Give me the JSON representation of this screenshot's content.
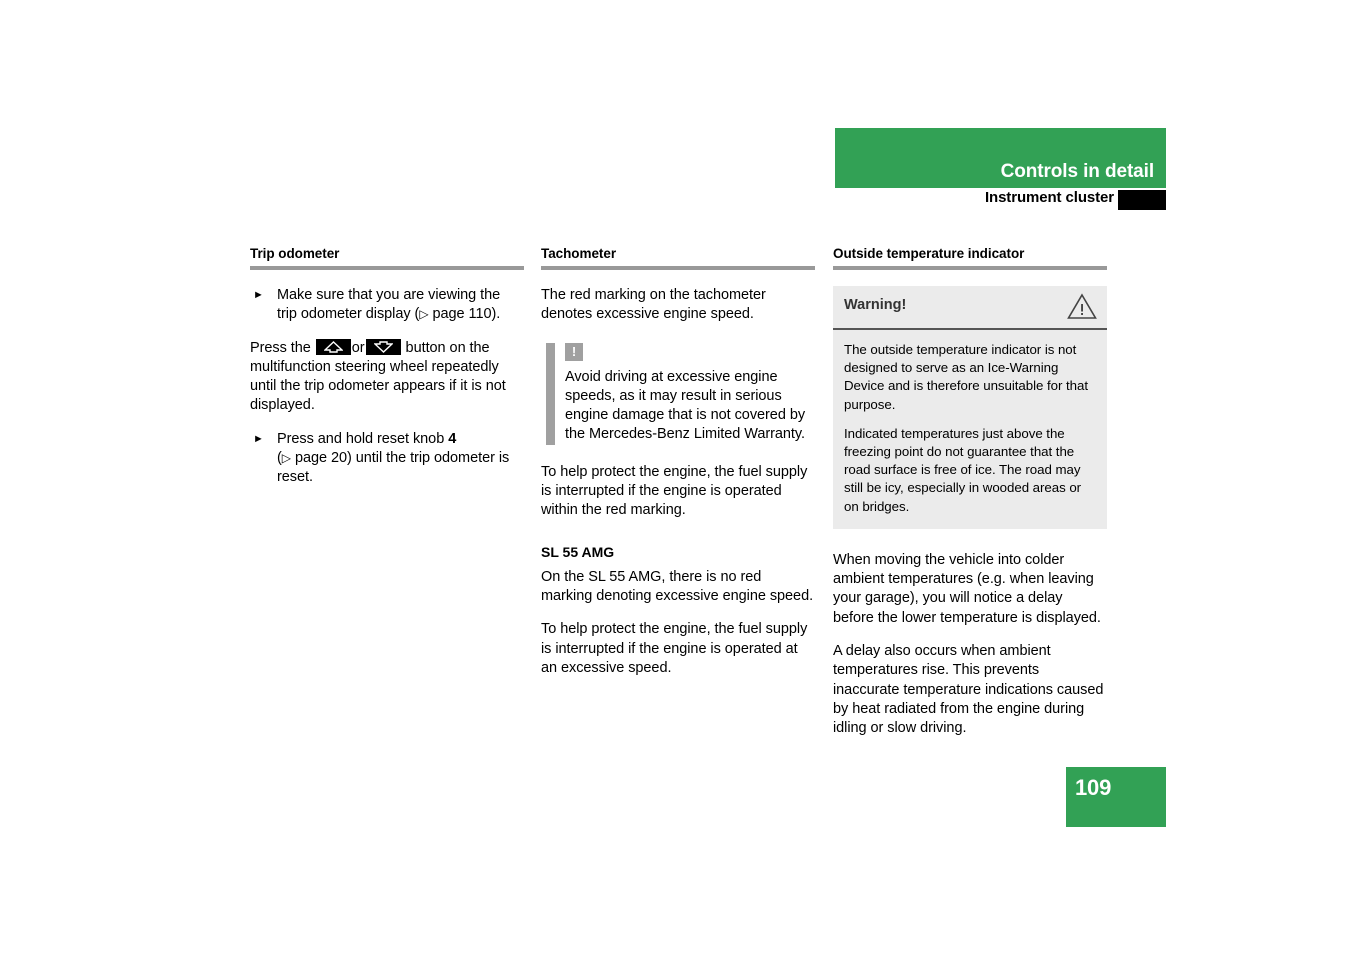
{
  "header": {
    "banner_title": "Controls in detail",
    "subtitle": "Instrument cluster"
  },
  "columns": {
    "trip_odometer": {
      "heading": "Trip odometer",
      "bullet_1_text": "Make sure that you are viewing the trip odometer display (",
      "bullet_1_arrow": "▷",
      "bullet_1_pageref": " page 110).",
      "paragraph_press_pre": "Press the ",
      "paragraph_press_or": "or",
      "paragraph_press_post": " button on the multifunction steering wheel repeatedly until the trip odometer appears if it is not displayed.",
      "bullet_2_pre": "Press and hold reset knob ",
      "bullet_2_bold": "4",
      "bullet_2_arrow": "▷",
      "bullet_2_post": " page 20) until the trip odometer is reset.",
      "up_button_icon": "up-arrow-key-icon",
      "down_button_icon": "down-arrow-key-icon"
    },
    "tachometer": {
      "heading": "Tachometer",
      "para_1": "The red marking on the tachometer denotes excessive engine speed.",
      "note": {
        "icon": "exclamation-icon",
        "icon_glyph": "!",
        "text": "Avoid driving at excessive engine speeds, as it may result in serious engine damage that is not covered by the Mercedes-Benz Limited Warranty."
      },
      "para_2": "To help protect the engine, the fuel supply is interrupted if the engine is operated within the red marking.",
      "sub_heading": "SL 55 AMG",
      "para_3": "On the SL 55 AMG, there is no red marking denoting excessive engine speed.",
      "para_4": "To help protect the engine, the fuel supply is interrupted if the engine is operated at an excessive speed."
    },
    "outside_temperature": {
      "heading": "Outside temperature indicator",
      "warning_box": {
        "label": "Warning!",
        "icon": "warning-triangle-icon",
        "para_1": "The outside temperature indicator is not designed to serve as an Ice-Warning Device and is therefore unsuitable for that purpose.",
        "para_2": "Indicated temperatures just above the freezing point do not guarantee that the road surface is free of ice. The road may still be icy, especially in wooded areas or on bridges."
      },
      "para_1": "When moving the vehicle into colder ambient temperatures (e.g. when leaving your garage), you will notice a delay before the lower temperature is displayed.",
      "para_2": "A delay also occurs when ambient temperatures rise. This prevents inaccurate temperature indications caused by heat radiated from the engine during idling or slow driving."
    }
  },
  "footer": {
    "page_number": "109"
  },
  "colors": {
    "brand_green": "#32a155",
    "rule_gray": "#999999",
    "note_gray": "#a0a0a0",
    "warning_bg": "#ebebeb"
  }
}
